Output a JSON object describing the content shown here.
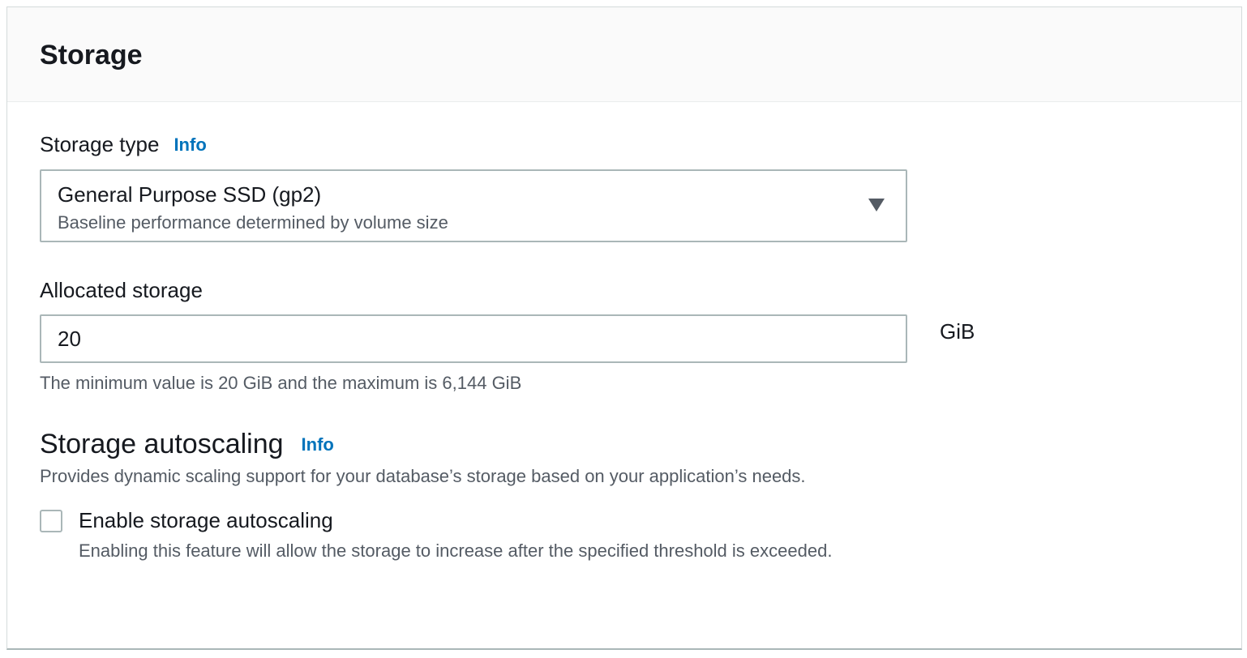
{
  "panel": {
    "title": "Storage"
  },
  "storage_type": {
    "label": "Storage type",
    "info": "Info",
    "selected_value": "General Purpose SSD (gp2)",
    "selected_description": "Baseline performance determined by volume size"
  },
  "allocated_storage": {
    "label": "Allocated storage",
    "value": "20",
    "unit": "GiB",
    "constraint": "The minimum value is 20 GiB and the maximum is 6,144 GiB"
  },
  "autoscaling": {
    "heading": "Storage autoscaling",
    "info": "Info",
    "description": "Provides dynamic scaling support for your database’s storage based on your application’s needs.",
    "checkbox_label": "Enable storage autoscaling",
    "checkbox_description": "Enabling this feature will allow the storage to increase after the specified threshold is exceeded.",
    "checked": false
  },
  "icons": {
    "dropdown": "caret-down-icon"
  },
  "colors": {
    "link": "#0073bb",
    "border": "#aab7b8",
    "header_bg": "#fafafa",
    "text": "#16191f",
    "secondary_text": "#545b64"
  }
}
